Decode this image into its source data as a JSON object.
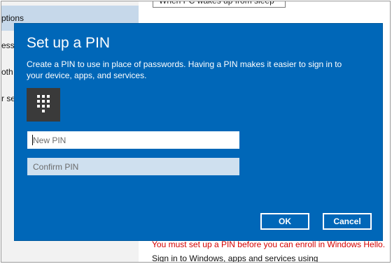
{
  "background": {
    "sidebar_items": [
      "ptions",
      "ess",
      "oth",
      "r se"
    ],
    "top_field_value": "When PC wakes up from sleep",
    "warning_text": "You must set up a PIN before you can enroll in Windows Hello.",
    "signin_text": "Sign in to Windows, apps and services using"
  },
  "dialog": {
    "title": "Set up a PIN",
    "description": "Create a PIN to use in place of passwords. Having a PIN makes it easier to sign in to your device, apps, and services.",
    "icon": "keypad-icon",
    "new_pin_placeholder": "New PIN",
    "confirm_pin_placeholder": "Confirm PIN",
    "ok_label": "OK",
    "cancel_label": "Cancel"
  },
  "colors": {
    "dialog_bg": "#0067b8",
    "warning": "#d40000",
    "sidebar_selected": "#c6d8ea"
  }
}
